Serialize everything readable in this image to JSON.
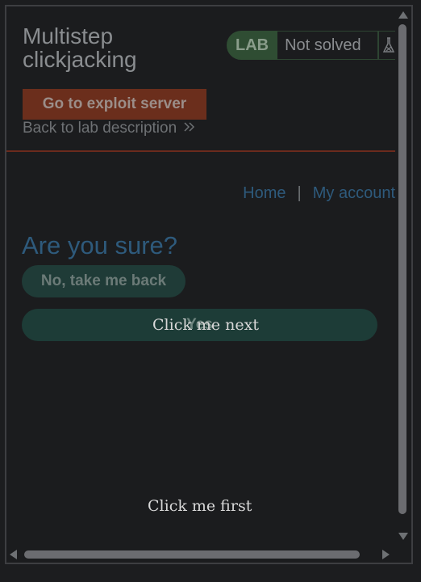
{
  "header": {
    "title": "Multistep clickjacking",
    "lab_badge": "LAB",
    "lab_status": "Not solved",
    "exploit_button": "Go to exploit server",
    "back_link": "Back to lab description"
  },
  "nav": {
    "home": "Home",
    "separator": "|",
    "account": "My account"
  },
  "confirm": {
    "heading": "Are you sure?",
    "no_button": "No, take me back",
    "yes_button": "Yes"
  },
  "decoys": {
    "next": "Click me next",
    "first": "Click me first"
  },
  "colors": {
    "lab_badge": "#2f4d33",
    "exploit_button": "#6b2e1c",
    "link": "#2e5a7c",
    "button_teal": "#1f3b37"
  },
  "icons": {
    "flask": "flask-icon",
    "chevrons": "double-chevron-right-icon"
  }
}
